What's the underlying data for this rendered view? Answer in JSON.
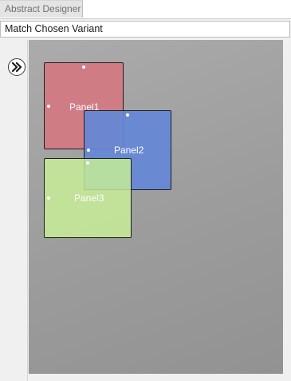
{
  "tabs": [
    {
      "label": "Abstract Designer"
    }
  ],
  "combo": {
    "value": "Match Chosen Variant"
  },
  "toolbar": {
    "expand_icon": "double-chevron-right-icon"
  },
  "designer": {
    "panels": [
      {
        "label": "Panel1",
        "color": "#d27882"
      },
      {
        "label": "Panel2",
        "color": "#6487d7"
      },
      {
        "label": "Panel3",
        "color": "#c8f096"
      }
    ]
  },
  "colors": {
    "canvas": "#a0a0a0",
    "chrome": "#f0f0f0"
  }
}
